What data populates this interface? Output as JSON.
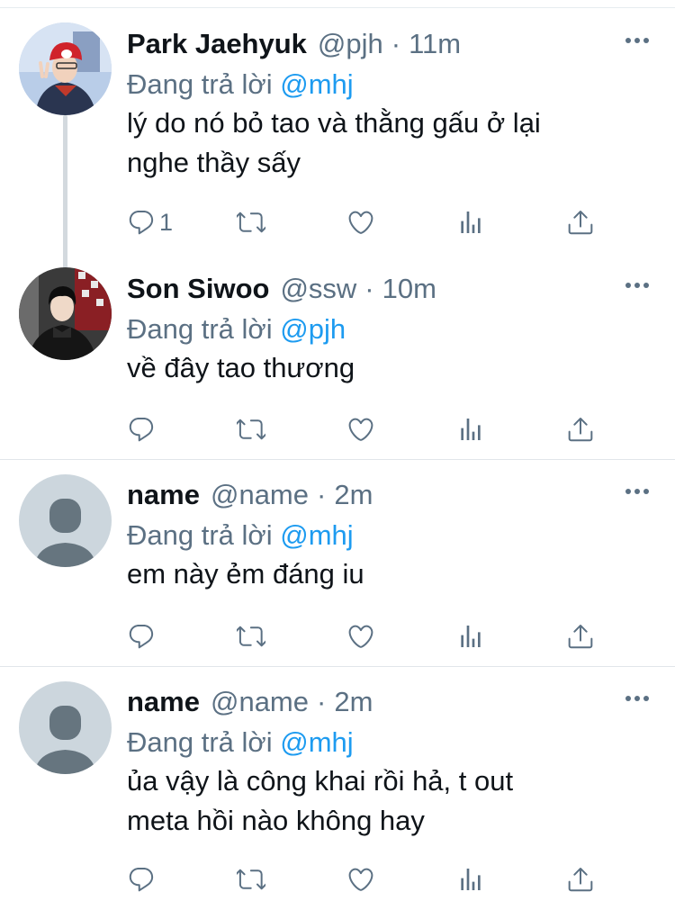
{
  "tweets": [
    {
      "name": "Park Jaehyuk",
      "handle": "@pjh",
      "time": "11m",
      "reply_prefix": "Đang trả lời",
      "reply_mention": "@mhj",
      "lines": [
        "lý do nó bỏ tao và thằng gấu ở lại",
        "nghe thầy sấy"
      ],
      "reply_count": "1",
      "avatar": "photo-red-cap"
    },
    {
      "name": "Son Siwoo",
      "handle": "@ssw",
      "time": "10m",
      "reply_prefix": "Đang trả lời",
      "reply_mention": "@pjh",
      "lines": [
        "về đây tao thương"
      ],
      "reply_count": "",
      "avatar": "photo-dark-coat"
    },
    {
      "name": "name",
      "handle": "@name",
      "time": "2m",
      "reply_prefix": "Đang trả lời",
      "reply_mention": "@mhj",
      "lines": [
        "em này ẻm đáng iu"
      ],
      "reply_count": "",
      "avatar": "default-avatar"
    },
    {
      "name": "name",
      "handle": "@name",
      "time": "2m",
      "reply_prefix": "Đang trả lời",
      "reply_mention": "@mhj",
      "lines": [
        "ủa vậy là công khai rồi hả, t out",
        "meta hồi nào không hay"
      ],
      "reply_count": "",
      "avatar": "default-avatar"
    }
  ],
  "icons": [
    "reply-icon",
    "retweet-icon",
    "like-icon",
    "analytics-icon",
    "share-icon",
    "more-icon"
  ],
  "colors": {
    "text": "#0f1419",
    "secondary": "#5b7083",
    "link": "#1d9bf0",
    "divider": "#e1e6ea"
  }
}
